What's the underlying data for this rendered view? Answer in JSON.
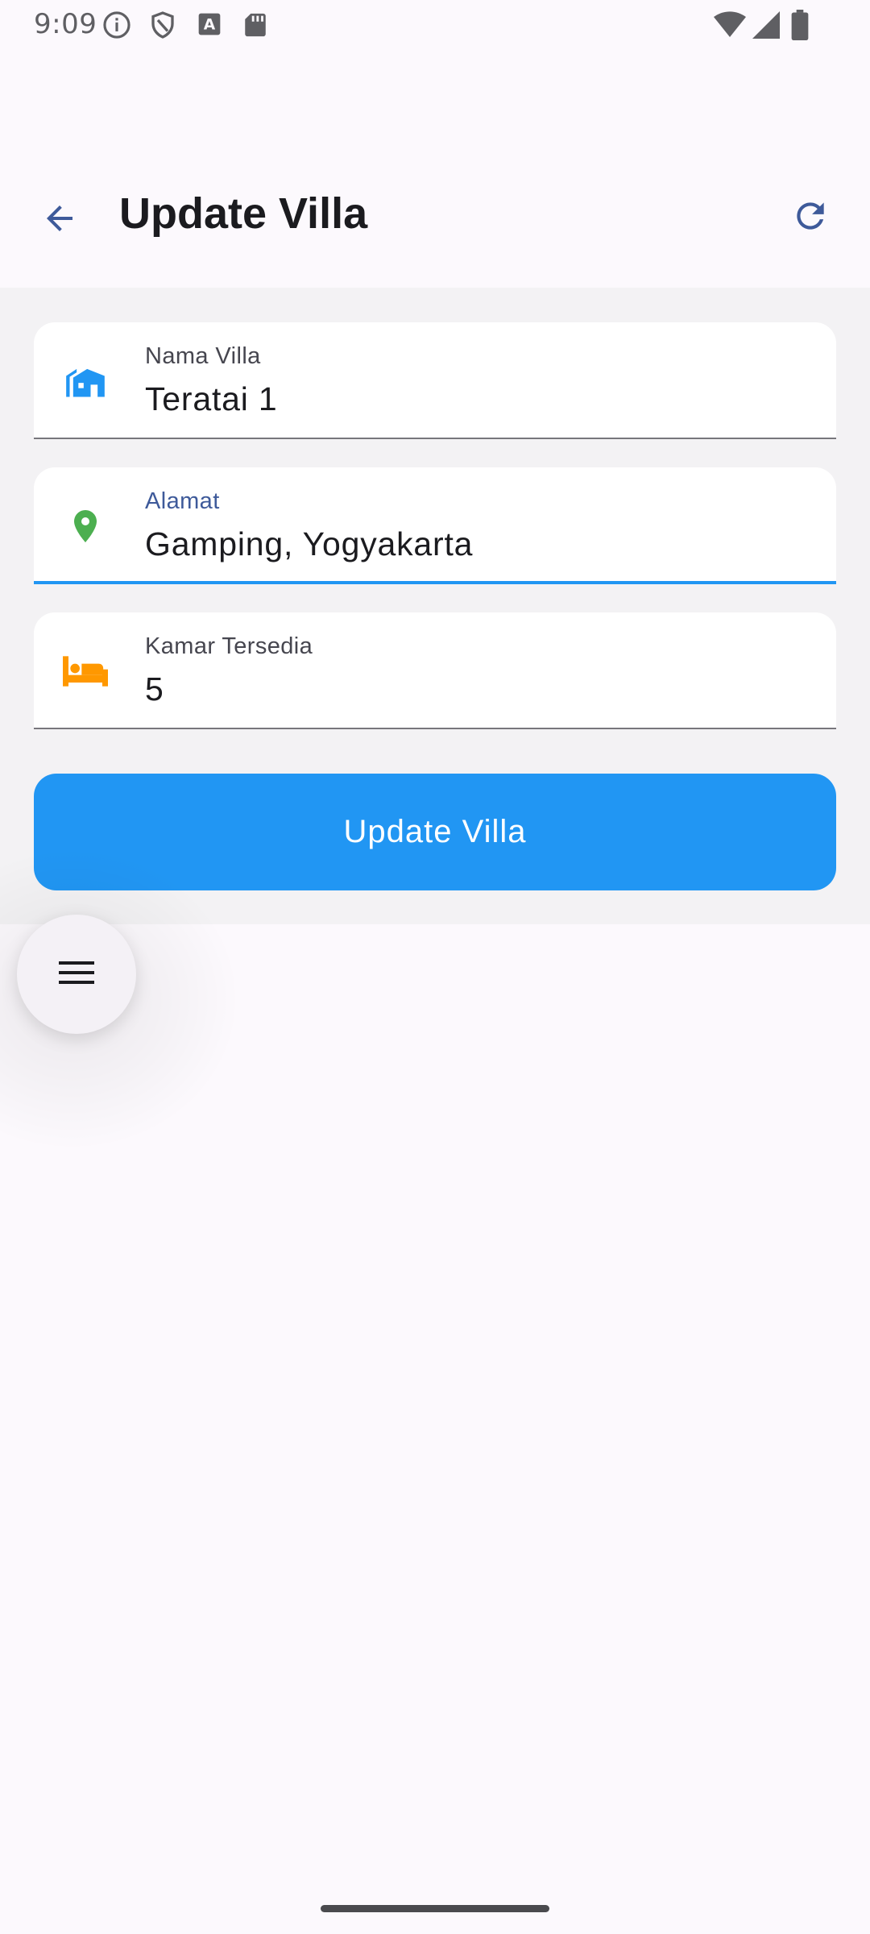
{
  "status_bar": {
    "time": "9:09",
    "left_icons": [
      "info-icon",
      "shield-icon",
      "text-a-icon",
      "sd-card-icon"
    ],
    "right_icons": [
      "wifi-icon",
      "signal-icon",
      "battery-icon"
    ]
  },
  "app_bar": {
    "title": "Update Villa",
    "back_icon": "arrow-back-icon",
    "refresh_icon": "refresh-icon"
  },
  "form": {
    "nama_villa": {
      "label": "Nama Villa",
      "value": "Teratai 1",
      "icon": "villa-icon",
      "icon_color": "#2196f3"
    },
    "alamat": {
      "label": "Alamat",
      "value": "Gamping, Yogyakarta",
      "icon": "location-pin-icon",
      "icon_color": "#4caf50"
    },
    "kamar_tersedia": {
      "label": "Kamar Tersedia",
      "value": "5",
      "icon": "bed-icon",
      "icon_color": "#ff9800"
    },
    "submit_label": "Update Villa"
  },
  "fab": {
    "icon": "menu-icon"
  },
  "colors": {
    "primary": "#2196f3",
    "background": "#fcf9fd",
    "content_bg": "#f3f2f4",
    "title": "#1b1b1f"
  }
}
